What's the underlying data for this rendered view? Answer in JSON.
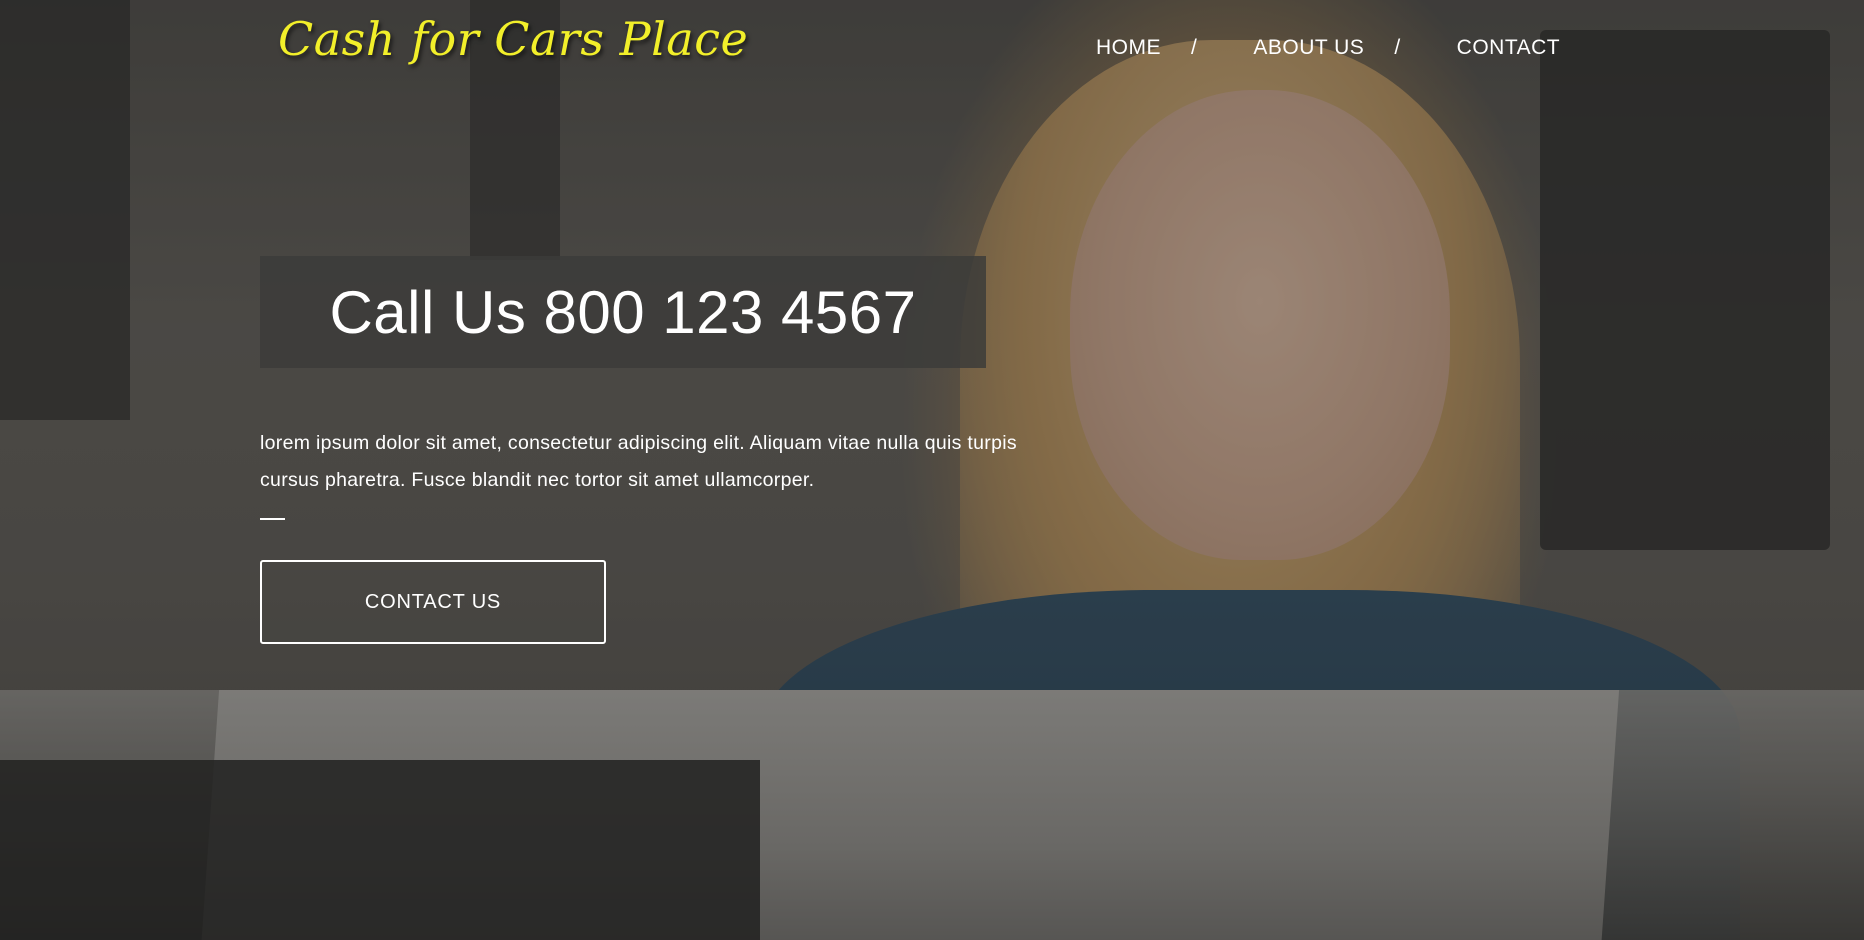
{
  "header": {
    "logo_text": "Cash for Cars Place",
    "nav": [
      {
        "label": "HOME"
      },
      {
        "label": "ABOUT US"
      },
      {
        "label": "CONTACT"
      }
    ],
    "separator": "/"
  },
  "hero": {
    "call_text": "Call Us 800 123 4567",
    "description": "lorem ipsum dolor sit amet, consectetur adipiscing elit. Aliquam vitae nulla quis turpis cursus pharetra. Fusce blandit nec tortor sit amet ullamcorper.",
    "cta_label": "CONTACT US"
  },
  "colors": {
    "logo": "#f2ef2a",
    "text": "#ffffff",
    "call_box": "#3c3c3a"
  }
}
